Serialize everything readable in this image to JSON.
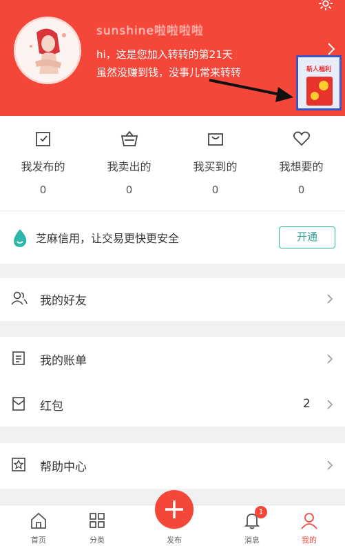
{
  "profile": {
    "username": "sunshine啦啦啦啦",
    "welcome_line1": "hi，这是您加入转转的第21天",
    "welcome_line2": "虽然没赚到钱，没事儿常来转转",
    "promo_title": "新人福利"
  },
  "stats": [
    {
      "label": "我发布的",
      "count": "0",
      "icon": "post-icon"
    },
    {
      "label": "我卖出的",
      "count": "0",
      "icon": "basket-icon"
    },
    {
      "label": "我买到的",
      "count": "0",
      "icon": "bag-icon"
    },
    {
      "label": "我想要的",
      "count": "0",
      "icon": "heart-icon"
    }
  ],
  "zhima": {
    "text": "芝麻信用，让交易更快更安全",
    "button": "开通"
  },
  "menu": {
    "friends": "我的好友",
    "bill": "我的账单",
    "redpacket": "红包",
    "redpacket_count": "2",
    "help": "帮助中心"
  },
  "tabs": [
    {
      "label": "首页",
      "icon": "home-icon"
    },
    {
      "label": "分类",
      "icon": "grid-icon"
    },
    {
      "label": "发布",
      "icon": "plus-icon"
    },
    {
      "label": "消息",
      "icon": "bell-icon",
      "badge": "1"
    },
    {
      "label": "我的",
      "icon": "person-icon",
      "active": true
    }
  ],
  "colors": {
    "brand": "#f4473a",
    "accent": "#33b5a0"
  }
}
